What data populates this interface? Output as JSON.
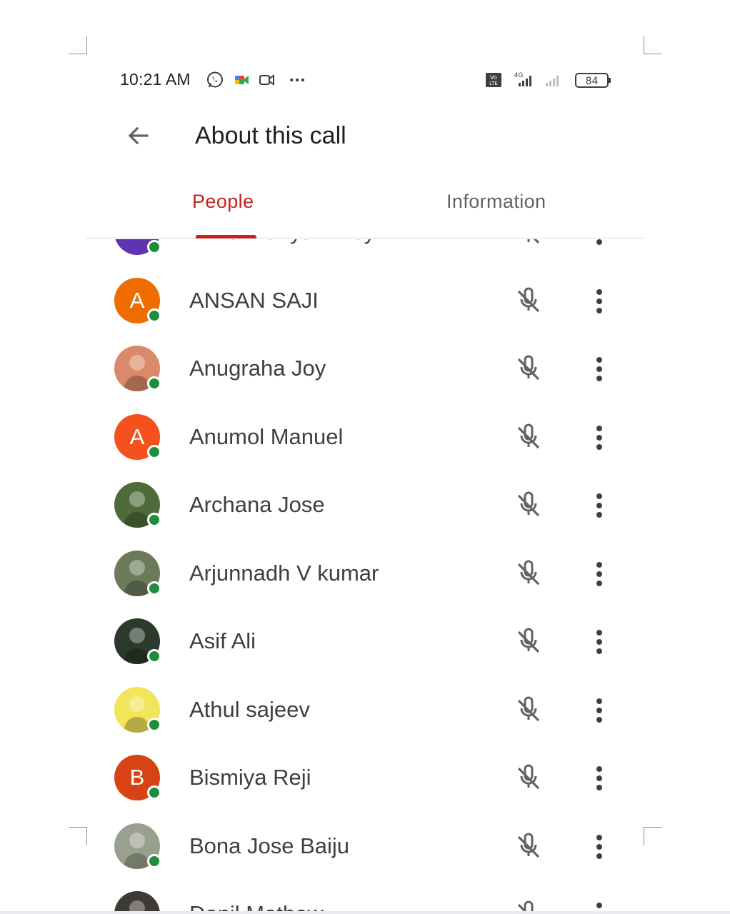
{
  "status_bar": {
    "time": "10:21 AM",
    "network": "4G",
    "battery": "84"
  },
  "app_bar": {
    "title": "About this call"
  },
  "tabs": [
    {
      "label": "People",
      "active": true
    },
    {
      "label": "Information",
      "active": false
    }
  ],
  "participants": [
    {
      "name": "Anna Mariya Biney",
      "avatar_letter": "A",
      "avatar_color": "#5e35b1",
      "partially_visible": true
    },
    {
      "name": "ANSAN SAJI",
      "avatar_letter": "A",
      "avatar_color": "#ef6c00"
    },
    {
      "name": "Anugraha Joy",
      "avatar_letter": "",
      "avatar_color": "#d98a6a",
      "photo": "photo-avatar"
    },
    {
      "name": "Anumol Manuel",
      "avatar_letter": "A",
      "avatar_color": "#f4511e"
    },
    {
      "name": "Archana Jose",
      "avatar_letter": "",
      "avatar_color": "#4e6b3a",
      "photo": "photo-avatar"
    },
    {
      "name": "Arjunnadh V kumar",
      "avatar_letter": "",
      "avatar_color": "#6b7b5a",
      "photo": "photo-avatar"
    },
    {
      "name": "Asif Ali",
      "avatar_letter": "",
      "avatar_color": "#2b3a2b",
      "photo": "photo-avatar"
    },
    {
      "name": "Athul sajeev",
      "avatar_letter": "",
      "avatar_color": "#f3e55a",
      "photo": "photo-avatar"
    },
    {
      "name": "Bismiya Reji",
      "avatar_letter": "B",
      "avatar_color": "#d84315"
    },
    {
      "name": "Bona Jose Baiju",
      "avatar_letter": "",
      "avatar_color": "#9aa08e",
      "photo": "photo-avatar"
    },
    {
      "name": "Danil Mathew",
      "avatar_letter": "",
      "avatar_color": "#3d3a36",
      "photo": "photo-avatar",
      "partially_visible": true
    }
  ],
  "icons": {
    "back": "arrow-back-icon",
    "mic": "mic-off-icon",
    "more": "more-vert-icon",
    "online": "online-dot"
  },
  "colors": {
    "accent": "#c5221f",
    "online": "#1e8e3e",
    "text": "#3c4043"
  }
}
